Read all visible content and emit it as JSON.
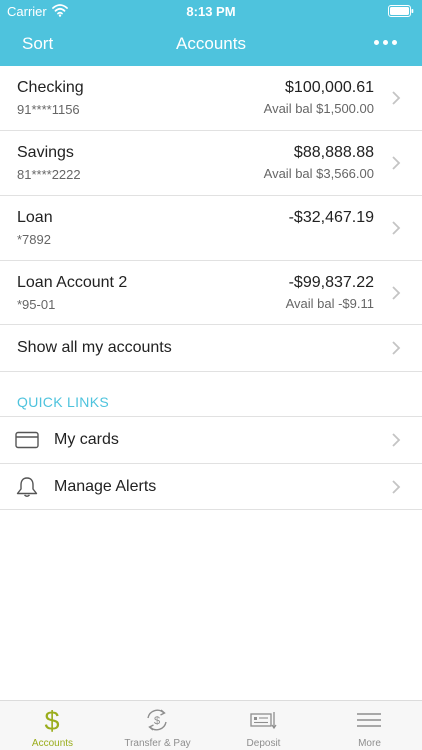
{
  "status_bar": {
    "carrier": "Carrier",
    "time": "8:13 PM",
    "wifi_icon": "wifi-icon",
    "battery_icon": "battery-icon"
  },
  "navbar": {
    "left_label": "Sort",
    "title": "Accounts",
    "more_icon": "more-dots-icon"
  },
  "accounts": [
    {
      "name": "Checking",
      "number": "91****1156",
      "balance": "$100,000.61",
      "available": "Avail bal $1,500.00"
    },
    {
      "name": "Savings",
      "number": "81****2222",
      "balance": "$88,888.88",
      "available": "Avail bal $3,566.00"
    },
    {
      "name": "Loan",
      "number": "*7892",
      "balance": "-$32,467.19",
      "available": ""
    },
    {
      "name": "Loan Account 2",
      "number": "*95-01",
      "balance": "-$99,837.22",
      "available": "Avail bal -$9.11"
    }
  ],
  "show_all": {
    "label": "Show all my accounts"
  },
  "quick_links": {
    "header": "QUICK LINKS",
    "items": [
      {
        "label": "My cards",
        "icon": "card-icon"
      },
      {
        "label": "Manage Alerts",
        "icon": "bell-icon"
      }
    ]
  },
  "tabbar": {
    "tabs": [
      {
        "label": "Accounts",
        "icon": "dollar-icon",
        "active": true
      },
      {
        "label": "Transfer & Pay",
        "icon": "transfer-icon",
        "active": false
      },
      {
        "label": "Deposit",
        "icon": "check-deposit-icon",
        "active": false
      },
      {
        "label": "More",
        "icon": "menu-icon",
        "active": false
      }
    ]
  },
  "colors": {
    "header": "#4ec3dd",
    "accent_link": "#4ec3dd",
    "active_tab": "#9aad1c",
    "inactive_tab": "#8e8e8e"
  }
}
